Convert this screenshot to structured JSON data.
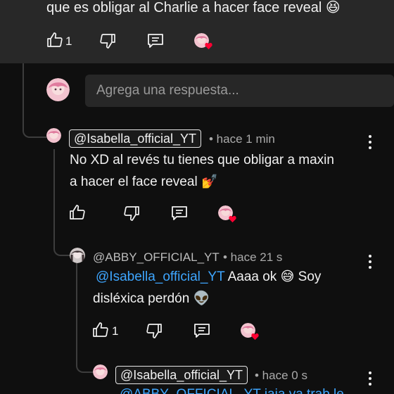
{
  "top_comment": {
    "text_tail": "que es obligar al Charlie a hacer face reveal 😆",
    "like_count": "1",
    "icons": [
      "thumb-up-icon",
      "thumb-down-icon",
      "reply-icon",
      "creator-heart"
    ]
  },
  "reply_input": {
    "placeholder": "Agrega una respuesta..."
  },
  "reply1": {
    "handle": "@Isabella_official_YT",
    "time": "• hace 1 min",
    "text_line1": "No XD al revés tu tienes que obligar a maxin",
    "text_line2": "a hacer el face reveal 💅",
    "like_count": ""
  },
  "reply2": {
    "handle": "@ABBY_OFFICIAL_YT",
    "time": "• hace 21 s",
    "mention": "@Isabella_official_YT",
    "text_line1_rest": " Aaaa ok 😅 Soy",
    "text_line2": "disléxica perdón 👽",
    "like_count": "1"
  },
  "reply3": {
    "handle": "@Isabella_official_YT",
    "time": "• hace 0 s",
    "text_partial": "@ABBY_OFFICIAL_YT jaja ya trab le"
  },
  "colors": {
    "background": "#0f0f0f",
    "top_panel": "#282828",
    "mention": "#3ea6ff",
    "heart": "#ff0033"
  }
}
